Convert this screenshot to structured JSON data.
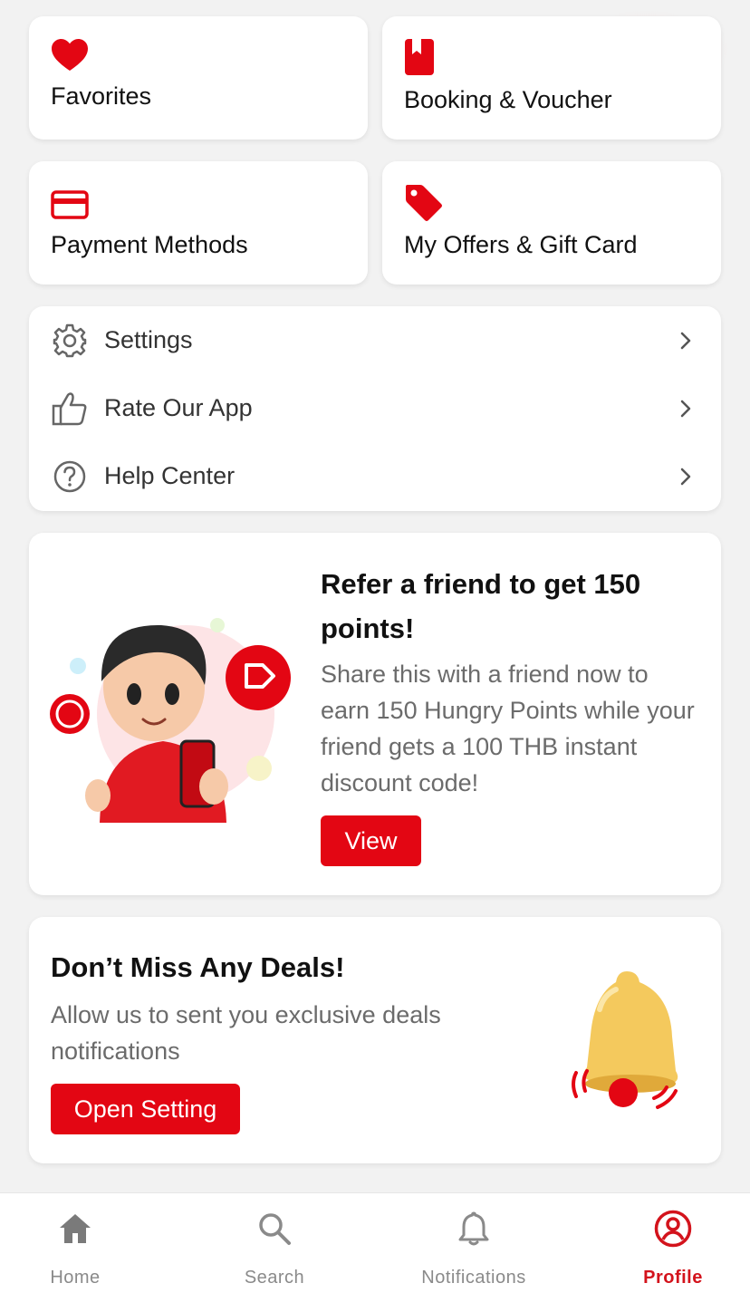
{
  "tiles": {
    "favorites": {
      "label": "Favorites",
      "icon": "heart-icon"
    },
    "booking": {
      "label": "Booking & Voucher",
      "icon": "bookmark-book-icon"
    },
    "payment": {
      "label": "Payment Methods",
      "icon": "credit-card-icon"
    },
    "offers": {
      "label": "My Offers & Gift Card",
      "icon": "tag-icon"
    }
  },
  "menu": {
    "items": [
      {
        "label": "Settings",
        "icon": "gear-icon"
      },
      {
        "label": "Rate Our App",
        "icon": "thumbs-up-icon"
      },
      {
        "label": "Help Center",
        "icon": "question-circle-icon"
      }
    ]
  },
  "refer": {
    "title": "Refer a friend to get 150 points!",
    "description": "Share this with a friend now to earn 150 Hungry Points while your friend gets a 100 THB instant discount code!",
    "button": "View"
  },
  "deals": {
    "title": "Don’t Miss Any Deals!",
    "description": "Allow us to sent you exclusive deals notifications",
    "button": "Open Setting"
  },
  "nav": {
    "items": [
      {
        "label": "Home",
        "icon": "home-icon",
        "active": false
      },
      {
        "label": "Search",
        "icon": "search-icon",
        "active": false
      },
      {
        "label": "Notifications",
        "icon": "bell-icon",
        "active": false
      },
      {
        "label": "Profile",
        "icon": "user-circle-icon",
        "active": true
      }
    ]
  },
  "colors": {
    "brand_red": "#e30613",
    "active_nav": "#d3131c",
    "icon_gray": "#666666",
    "nav_inactive": "#8a8a8a"
  }
}
